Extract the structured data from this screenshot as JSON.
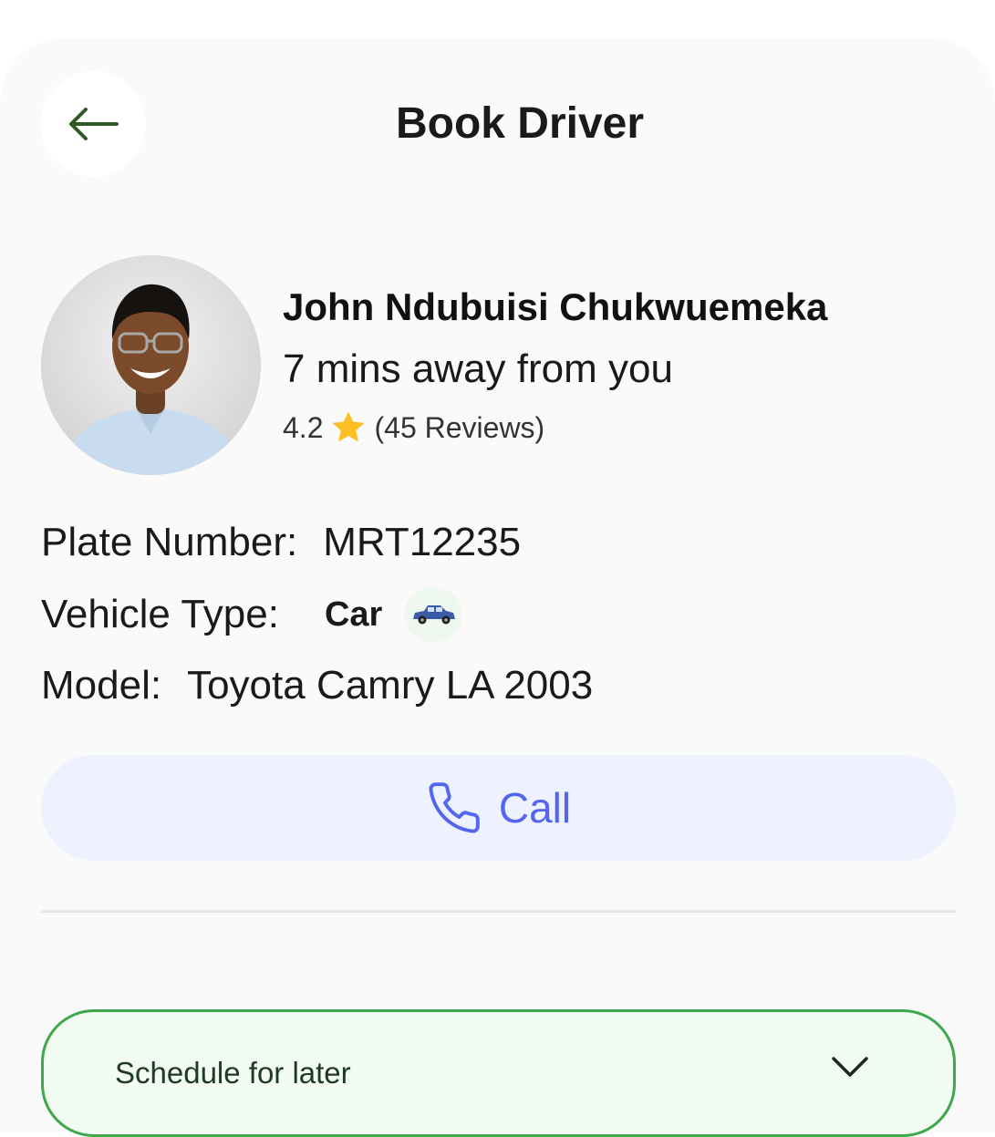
{
  "header": {
    "title": "Book Driver",
    "back_icon": "arrow-left-icon"
  },
  "driver": {
    "name": "John Ndubuisi Chukwuemeka",
    "eta": "7 mins away from you",
    "rating": "4.2",
    "reviews": "(45 Reviews)",
    "star_color": "#fbbf24"
  },
  "details": {
    "plate_label": "Plate Number:",
    "plate_value": "MRT12235",
    "vehicle_label": "Vehicle Type:",
    "vehicle_value": "Car",
    "vehicle_icon": "car-icon",
    "model_label": "Model:",
    "model_value": "Toyota Camry LA 2003"
  },
  "actions": {
    "call_label": "Call",
    "call_icon": "phone-icon",
    "call_color": "#5465f0",
    "schedule_label": "Schedule for later",
    "schedule_icon": "chevron-down-icon",
    "accent_green": "#3ea84a"
  }
}
